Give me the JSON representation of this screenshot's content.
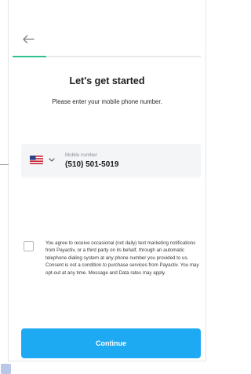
{
  "header": {
    "back_icon": "arrow-left-icon",
    "progress_fraction": 0.18,
    "progress_color": "#2fc08f"
  },
  "main": {
    "title": "Let's get started",
    "subtitle": "Please enter your mobile phone number."
  },
  "phone": {
    "country_flag_icon": "us-flag-icon",
    "dropdown_icon": "chevron-down-icon",
    "label": "Mobile number",
    "value": "(510) 501-5019"
  },
  "consent": {
    "checked": false,
    "text": "You agree to receive occasional (not daily) text marketing notifications from Payactiv, or a third party on its behalf, through an automatic telephone dialing system at any phone number you provided to us. Consent is not a condition to purchase services from Payactiv. You may opt-out at any time. Message and Data rates may apply."
  },
  "footer": {
    "continue_label": "Continue",
    "button_color": "#1ea9f3"
  }
}
